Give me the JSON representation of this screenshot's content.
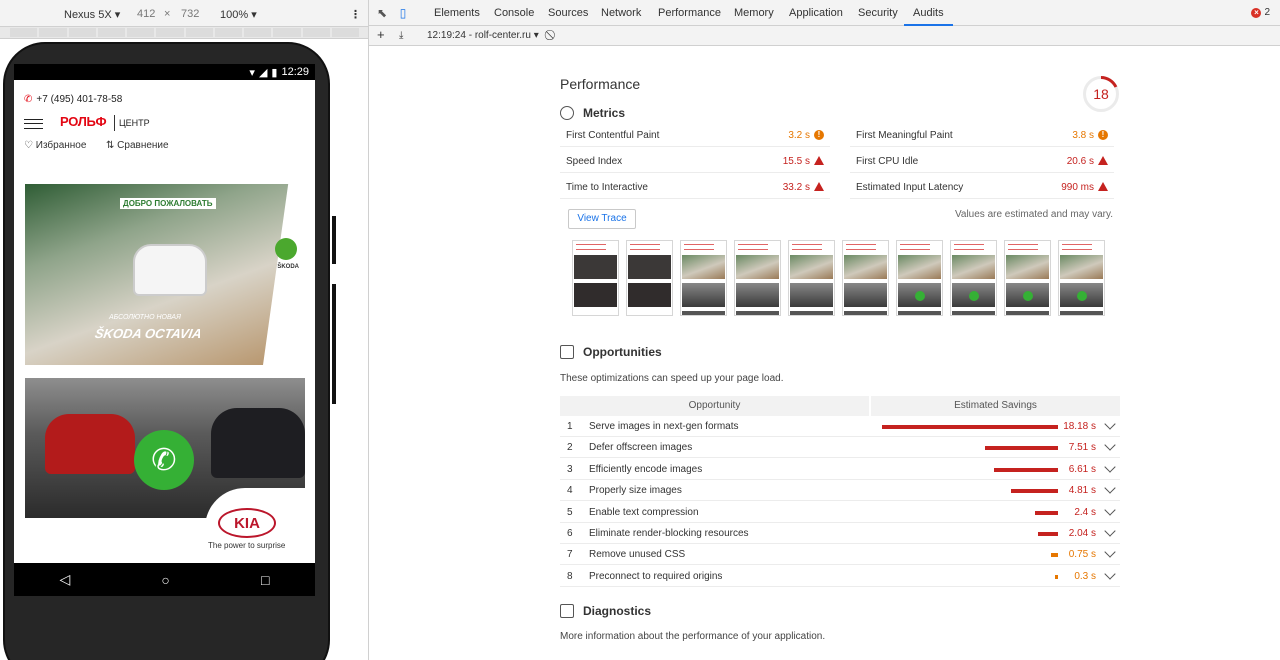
{
  "device_toolbar": {
    "device": "Nexus 5X",
    "width": "412",
    "times": "×",
    "height": "732",
    "zoom": "100%"
  },
  "phone": {
    "status_time": "12:29",
    "site_phone": "+7 (495) 401-78-58",
    "logo_text": "РОЛЬФ",
    "logo_sub": "ЦЕНТР",
    "favorites": "Избранное",
    "compare": "Сравнение",
    "banner1_title": "ДОБРО ПОЖАЛОВАТЬ",
    "banner1_caption": "АБСОЛЮТНО НОВАЯ",
    "banner1_model": "ŠKODA OCTAVIA",
    "skoda_label": "ŠKODA",
    "kia_logo": "KIA",
    "kia_slogan": "The power to surprise"
  },
  "devtools": {
    "tabs": [
      "Elements",
      "Console",
      "Sources",
      "Network",
      "Performance",
      "Memory",
      "Application",
      "Security",
      "Audits"
    ],
    "active_tab": "Audits",
    "error_count": "2",
    "report_label": "12:19:24 - rolf-center.ru",
    "accent": "#1a73e8"
  },
  "report": {
    "category_title": "Performance",
    "score": "18",
    "score_value": 18,
    "score_color": "#c5221f",
    "metrics_title": "Metrics",
    "metrics": [
      {
        "name": "First Contentful Paint",
        "value": "3.2 s",
        "status": "average"
      },
      {
        "name": "First Meaningful Paint",
        "value": "3.8 s",
        "status": "average"
      },
      {
        "name": "Speed Index",
        "value": "15.5 s",
        "status": "fail"
      },
      {
        "name": "First CPU Idle",
        "value": "20.6 s",
        "status": "fail"
      },
      {
        "name": "Time to Interactive",
        "value": "33.2 s",
        "status": "fail"
      },
      {
        "name": "Estimated Input Latency",
        "value": "990 ms",
        "status": "fail"
      }
    ],
    "view_trace": "View Trace",
    "estimate_note": "Values are estimated and may vary.",
    "opportunities_title": "Opportunities",
    "opportunities_desc": "These optimizations can speed up your page load.",
    "opp_col_1": "Opportunity",
    "opp_col_2": "Estimated Savings",
    "opportunities": [
      {
        "num": "1",
        "name": "Serve images in next-gen formats",
        "savings": "18.18 s",
        "seconds": 18.18,
        "status": "fail"
      },
      {
        "num": "2",
        "name": "Defer offscreen images",
        "savings": "7.51 s",
        "seconds": 7.51,
        "status": "fail"
      },
      {
        "num": "3",
        "name": "Efficiently encode images",
        "savings": "6.61 s",
        "seconds": 6.61,
        "status": "fail"
      },
      {
        "num": "4",
        "name": "Properly size images",
        "savings": "4.81 s",
        "seconds": 4.81,
        "status": "fail"
      },
      {
        "num": "5",
        "name": "Enable text compression",
        "savings": "2.4 s",
        "seconds": 2.4,
        "status": "fail"
      },
      {
        "num": "6",
        "name": "Eliminate render-blocking resources",
        "savings": "2.04 s",
        "seconds": 2.04,
        "status": "fail"
      },
      {
        "num": "7",
        "name": "Remove unused CSS",
        "savings": "0.75 s",
        "seconds": 0.75,
        "status": "average"
      },
      {
        "num": "8",
        "name": "Preconnect to required origins",
        "savings": "0.3 s",
        "seconds": 0.3,
        "status": "average"
      }
    ],
    "diagnostics_title": "Diagnostics",
    "diagnostics_desc": "More information about the performance of your application."
  }
}
